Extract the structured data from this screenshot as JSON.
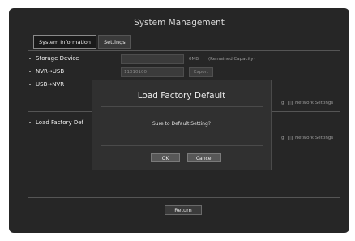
{
  "window": {
    "title": "System Management"
  },
  "tabs": [
    {
      "label": "System Information",
      "active": true
    },
    {
      "label": "Settings",
      "active": false
    }
  ],
  "rows": {
    "storage_device": {
      "label": "Storage Device",
      "size_value": "0MB",
      "remained": "(Remained Capacity)"
    },
    "nvr_usb": {
      "label": "NVR→USB",
      "field_value": "11010100",
      "export_label": "Export"
    },
    "usb_nvr": {
      "label": "USB→NVR",
      "partial_text": "g",
      "network_settings": "Network Settings"
    },
    "load_factory": {
      "label": "Load Factory Def",
      "partial_text": "g",
      "network_settings": "Network Settings"
    }
  },
  "dialog": {
    "title": "Load Factory Default",
    "message": "Sure to Default Setting?",
    "ok_label": "OK",
    "cancel_label": "Cancel"
  },
  "footer": {
    "return_label": "Return"
  }
}
